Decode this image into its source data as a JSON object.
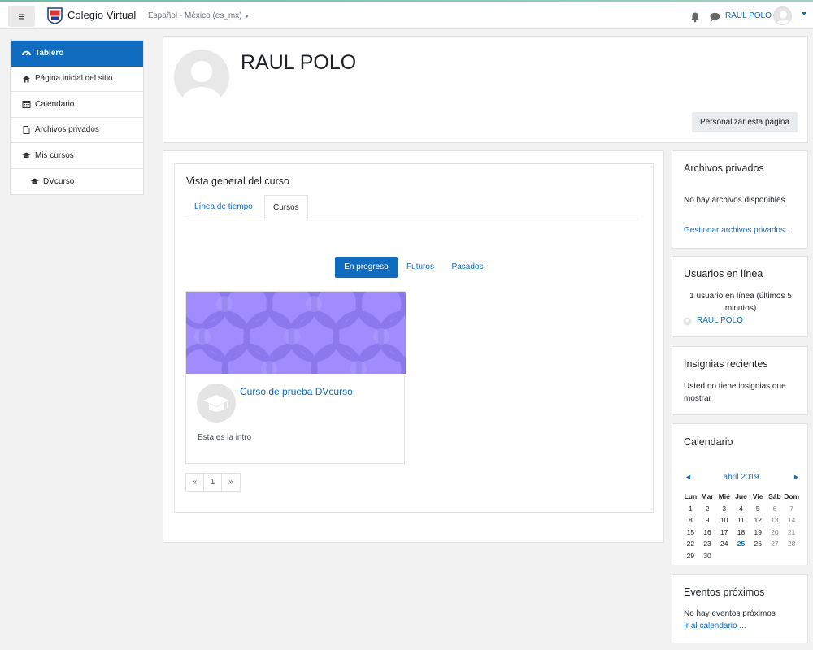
{
  "navbar": {
    "site_name": "Colegio Virtual",
    "language": "Español - México (es_mx)",
    "user_name": "RAUL POLO"
  },
  "sidebar": {
    "items": [
      {
        "label": "Tablero",
        "icon": "dashboard-icon"
      },
      {
        "label": "Página inicial del sitio",
        "icon": "home-icon"
      },
      {
        "label": "Calendario",
        "icon": "calendar-icon"
      },
      {
        "label": "Archivos privados",
        "icon": "file-icon"
      },
      {
        "label": "Mis cursos",
        "icon": "graduation-cap-icon"
      },
      {
        "label": "DVcurso",
        "icon": "graduation-cap-icon"
      }
    ]
  },
  "header": {
    "user_name": "RAUL POLO",
    "customize_label": "Personalizar esta página"
  },
  "overview": {
    "title": "Vista general del curso",
    "tabs": [
      "Línea de tiempo",
      "Cursos"
    ],
    "filters": [
      "En progreso",
      "Futuros",
      "Pasados"
    ],
    "course": {
      "name": "Curso de prueba DVcurso",
      "intro": "Esta es la intro"
    },
    "pagination": [
      "«",
      "1",
      "»"
    ]
  },
  "blocks": {
    "private_files": {
      "title": "Archivos privados",
      "empty": "No hay archivos disponibles",
      "manage_link": "Gestionar archivos privados..."
    },
    "online_users": {
      "title": "Usuarios en línea",
      "summary": "1 usuario en línea (últimos 5 minutos)",
      "user": "RAUL POLO"
    },
    "badges": {
      "title": "Insignias recientes",
      "empty": "Usted no tiene insignias que mostrar"
    },
    "calendar": {
      "title": "Calendario",
      "month": "abril 2019",
      "prev": "◄",
      "next": "►",
      "days_of_week": [
        "Lun",
        "Mar",
        "Mié",
        "Jue",
        "Vie",
        "Sáb",
        "Dom"
      ],
      "weeks": [
        [
          "1",
          "2",
          "3",
          "4",
          "5",
          "6",
          "7"
        ],
        [
          "8",
          "9",
          "10",
          "11",
          "12",
          "13",
          "14"
        ],
        [
          "15",
          "16",
          "17",
          "18",
          "19",
          "20",
          "21"
        ],
        [
          "22",
          "23",
          "24",
          "25",
          "26",
          "27",
          "28"
        ],
        [
          "29",
          "30",
          "",
          "",
          "",
          "",
          ""
        ]
      ],
      "today": "25"
    },
    "upcoming": {
      "title": "Eventos próximos",
      "empty": "No hay eventos próximos",
      "link": "Ir al calendario ..."
    }
  },
  "colors": {
    "primary": "#0f6cbf",
    "course_image": "#9c88ff"
  }
}
